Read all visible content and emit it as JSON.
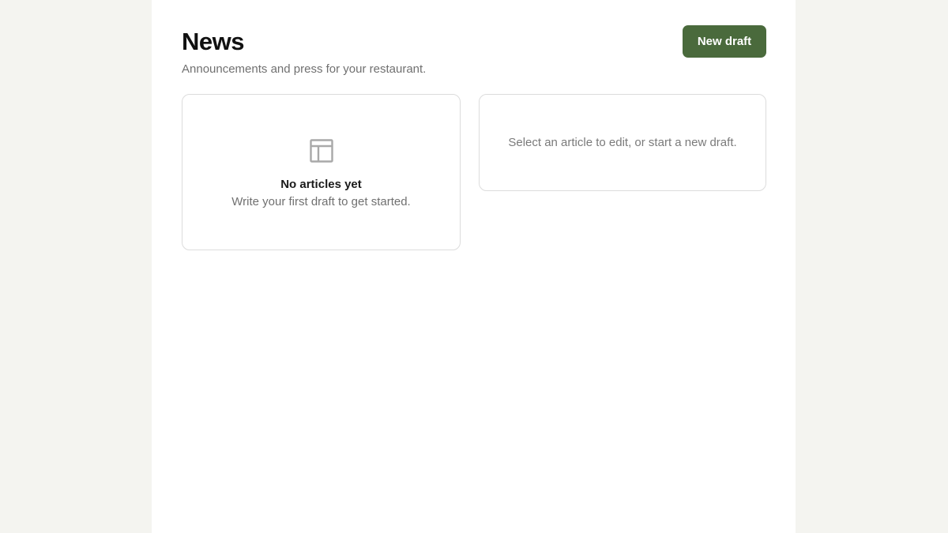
{
  "header": {
    "title": "News",
    "subtitle": "Announcements and press for your restaurant.",
    "new_draft_label": "New draft"
  },
  "articles_panel": {
    "icon": "layout-icon",
    "empty_title": "No articles yet",
    "empty_text": "Write your first draft to get started."
  },
  "editor_panel": {
    "hint": "Select an article to edit, or start a new draft."
  },
  "colors": {
    "accent": "#4a6a3c",
    "page_background": "#f4f4f0",
    "panel_background": "#ffffff",
    "border": "#dcdcdc",
    "muted_text": "#707070"
  }
}
